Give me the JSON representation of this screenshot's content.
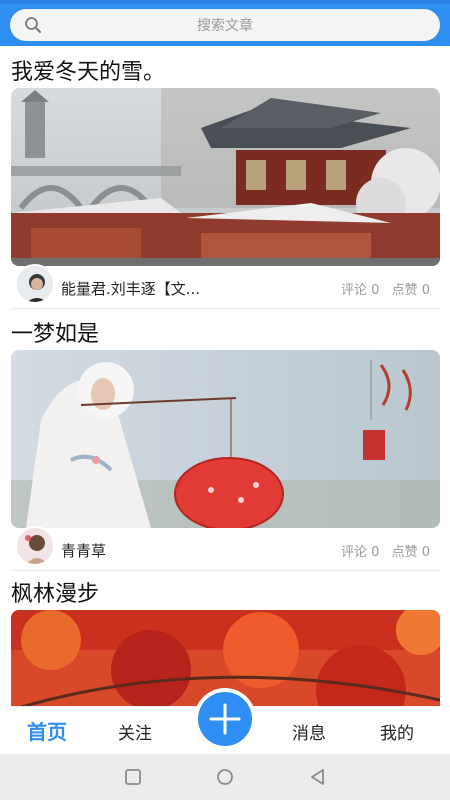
{
  "search": {
    "placeholder": "搜索文章",
    "icon": "search-icon"
  },
  "posts": [
    {
      "title": "我爱冬天的雪。",
      "author": "能量君.刘丰逐【文...",
      "comments": "评论 0",
      "likes": "点赞 0"
    },
    {
      "title": "一梦如是",
      "author": "青青草",
      "comments": "评论 0",
      "likes": "点赞 0"
    },
    {
      "title": "枫林漫步"
    }
  ],
  "tabs": {
    "home": "首页",
    "follow": "关注",
    "messages": "消息",
    "mine": "我的"
  },
  "colors": {
    "accent": "#2f8ef1"
  }
}
